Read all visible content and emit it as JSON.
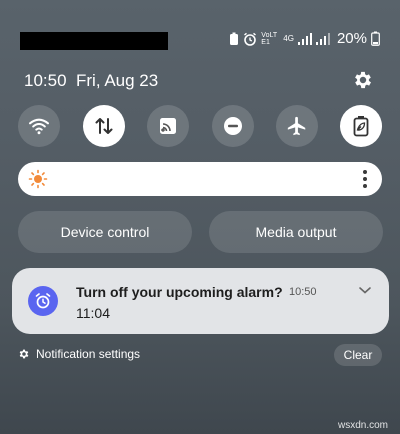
{
  "status_bar": {
    "battery_percent": "20%",
    "network_label": "4G",
    "volte_label": "VoLTE1"
  },
  "header": {
    "time": "10:50",
    "date": "Fri, Aug 23"
  },
  "quick_settings": {
    "tiles": [
      {
        "icon": "wifi-icon",
        "active": false
      },
      {
        "icon": "mobile-data-icon",
        "active": true
      },
      {
        "icon": "cast-icon",
        "active": false
      },
      {
        "icon": "do-not-disturb-icon",
        "active": false
      },
      {
        "icon": "airplane-icon",
        "active": false
      },
      {
        "icon": "battery-saver-icon",
        "active": true
      }
    ]
  },
  "brightness": {
    "icon": "sun-icon"
  },
  "device_control": {
    "label": "Device control"
  },
  "media_output": {
    "label": "Media output"
  },
  "notification": {
    "title": "Turn off your upcoming alarm?",
    "time": "10:50",
    "body": "11:04",
    "icon": "alarm-clock-icon",
    "badge_color": "#5a65f0"
  },
  "footer": {
    "settings_label": "Notification settings",
    "clear_label": "Clear"
  },
  "watermark": "wsxdn.com"
}
